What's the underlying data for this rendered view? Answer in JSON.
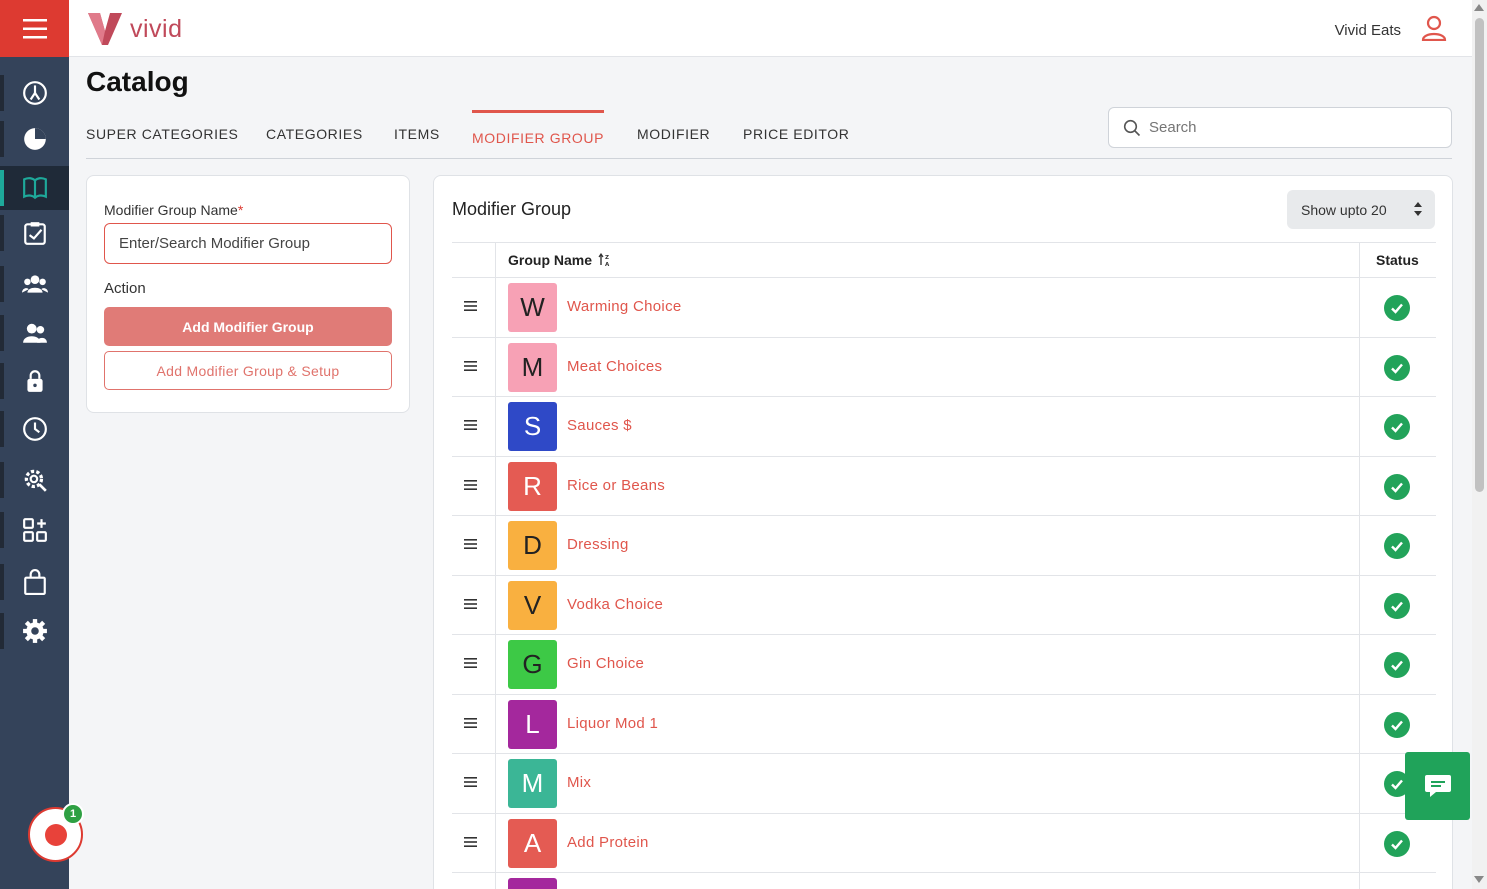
{
  "app": {
    "logo_text": "vivid",
    "user_name": "Vivid Eats"
  },
  "page": {
    "title": "Catalog"
  },
  "tabs": [
    {
      "label": "SUPER CATEGORIES",
      "active": false
    },
    {
      "label": "CATEGORIES",
      "active": false
    },
    {
      "label": "ITEMS",
      "active": false
    },
    {
      "label": "MODIFIER GROUP",
      "active": true
    },
    {
      "label": "MODIFIER",
      "active": false
    },
    {
      "label": "PRICE EDITOR",
      "active": false
    }
  ],
  "search": {
    "placeholder": "Search"
  },
  "sidebar": {
    "items": [
      {
        "icon": "dashboard-gauge-icon",
        "active": false
      },
      {
        "icon": "pie-chart-icon",
        "active": false
      },
      {
        "icon": "catalog-book-icon",
        "active": true
      },
      {
        "icon": "clipboard-check-icon",
        "active": false
      },
      {
        "icon": "users-group-icon",
        "active": false
      },
      {
        "icon": "staff-icon",
        "active": false
      },
      {
        "icon": "lock-icon",
        "active": false
      },
      {
        "icon": "clock-icon",
        "active": false
      },
      {
        "icon": "settings-search-icon",
        "active": false
      },
      {
        "icon": "apps-grid-icon",
        "active": false
      },
      {
        "icon": "shopping-bag-icon",
        "active": false
      },
      {
        "icon": "gear-icon",
        "active": false
      }
    ],
    "notification_count": "1"
  },
  "form": {
    "name_label": "Modifier Group Name",
    "required_mark": "*",
    "name_placeholder": "Enter/Search Modifier Group",
    "action_label": "Action",
    "add_button": "Add Modifier Group",
    "add_setup_button": "Add Modifier Group & Setup"
  },
  "list": {
    "title": "Modifier Group",
    "page_size_label": "Show upto 20",
    "columns": {
      "name": "Group Name",
      "status": "Status"
    },
    "rows": [
      {
        "initial": "W",
        "name": "Warming Choice",
        "color": "#f7a1b5",
        "light": false,
        "active": true
      },
      {
        "initial": "M",
        "name": "Meat Choices",
        "color": "#f7a1b5",
        "light": false,
        "active": true
      },
      {
        "initial": "S",
        "name": "Sauces $",
        "color": "#2f49c7",
        "light": true,
        "active": true
      },
      {
        "initial": "R",
        "name": "Rice or Beans",
        "color": "#e45b53",
        "light": true,
        "active": true
      },
      {
        "initial": "D",
        "name": "Dressing",
        "color": "#f9b040",
        "light": false,
        "active": true
      },
      {
        "initial": "V",
        "name": "Vodka Choice",
        "color": "#f9b040",
        "light": false,
        "active": true
      },
      {
        "initial": "G",
        "name": "Gin Choice",
        "color": "#3dc946",
        "light": false,
        "active": true
      },
      {
        "initial": "L",
        "name": "Liquor Mod 1",
        "color": "#a4289d",
        "light": true,
        "active": true
      },
      {
        "initial": "M",
        "name": "Mix",
        "color": "#3bb696",
        "light": true,
        "active": true
      },
      {
        "initial": "A",
        "name": "Add Protein",
        "color": "#e45b53",
        "light": true,
        "active": true
      },
      {
        "initial": "",
        "name": "",
        "color": "#a4289d",
        "light": true,
        "active": true
      }
    ]
  },
  "colors": {
    "brand": "#dd3a31",
    "accent": "#e0564c",
    "sidebar": "#34435a",
    "success": "#22a35a"
  }
}
